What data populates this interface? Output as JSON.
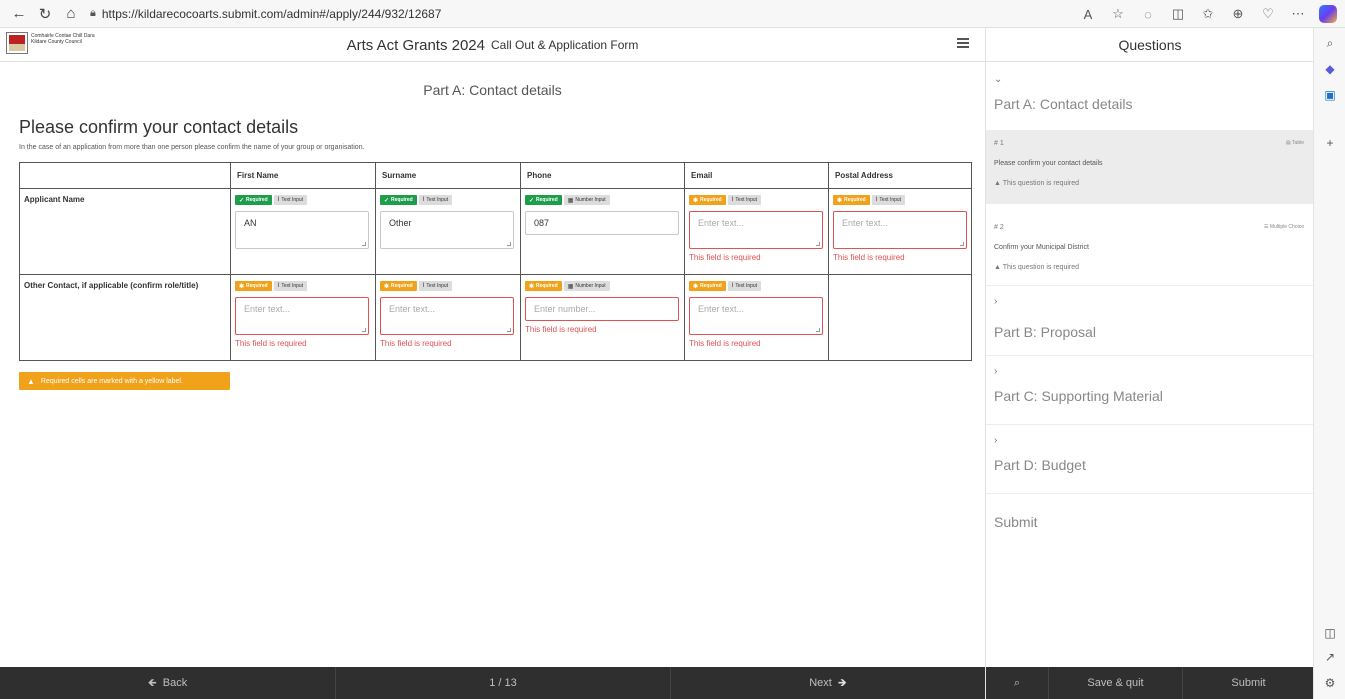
{
  "browser": {
    "url": "https://kildarecocoarts.submit.com/admin#/apply/244/932/12687"
  },
  "header": {
    "logo_line1": "Comhairle Contae Chill Dara",
    "logo_line2": "Kildare County Council",
    "title": "Arts Act Grants 2024",
    "subtitle": "Call Out & Application Form"
  },
  "main": {
    "part_heading": "Part A: Contact details",
    "question_title": "Please confirm your contact details",
    "question_description": "In the case of an application from more than one person please confirm the name of your group or organisation.",
    "columns": [
      "First Name",
      "Surname",
      "Phone",
      "Email",
      "Postal Address"
    ],
    "required_label": "Required",
    "text_input_label": "Text Input",
    "number_input_label": "Number Input",
    "error_text": "This field is required",
    "rows": [
      {
        "label": "Applicant Name",
        "cells": [
          {
            "value": "AN",
            "placeholder": "",
            "required_state": "ok",
            "type": "text"
          },
          {
            "value": "Other",
            "placeholder": "",
            "required_state": "ok",
            "type": "text"
          },
          {
            "value": "087",
            "placeholder": "",
            "required_state": "ok",
            "type": "number"
          },
          {
            "value": "",
            "placeholder": "Enter text...",
            "required_state": "need",
            "type": "text"
          },
          {
            "value": "",
            "placeholder": "Enter text...",
            "required_state": "need",
            "type": "text"
          }
        ]
      },
      {
        "label": "Other Contact, if applicable (confirm role/title)",
        "cells": [
          {
            "value": "",
            "placeholder": "Enter text...",
            "required_state": "need",
            "type": "text"
          },
          {
            "value": "",
            "placeholder": "Enter text...",
            "required_state": "need",
            "type": "text"
          },
          {
            "value": "",
            "placeholder": "Enter number...",
            "required_state": "need",
            "type": "number"
          },
          {
            "value": "",
            "placeholder": "Enter text...",
            "required_state": "need",
            "type": "text"
          }
        ]
      }
    ],
    "note": "Required cells are marked with a yellow label."
  },
  "bottom_bar": {
    "back": "Back",
    "page": "1 / 13",
    "next": "Next"
  },
  "panel": {
    "title": "Questions",
    "sections": [
      {
        "title": "Part A: Contact details",
        "expanded": true
      },
      {
        "title": "Part B: Proposal",
        "expanded": false
      },
      {
        "title": "Part C: Supporting Material",
        "expanded": false
      },
      {
        "title": "Part D: Budget",
        "expanded": false
      }
    ],
    "questions": [
      {
        "number": "# 1",
        "type": "Table",
        "text": "Please confirm your contact details",
        "required": "This question is required"
      },
      {
        "number": "# 2",
        "type": "Multiple Choice",
        "text": "Confirm your Municipal District",
        "required": "This question is required"
      }
    ],
    "submit_label": "Submit",
    "save_quit": "Save & quit",
    "submit_button": "Submit"
  },
  "colors": {
    "required_ok": "#1e9d4a",
    "required_missing": "#f0a21b",
    "error": "#e05252",
    "footer_bg": "#2f2f2f"
  }
}
